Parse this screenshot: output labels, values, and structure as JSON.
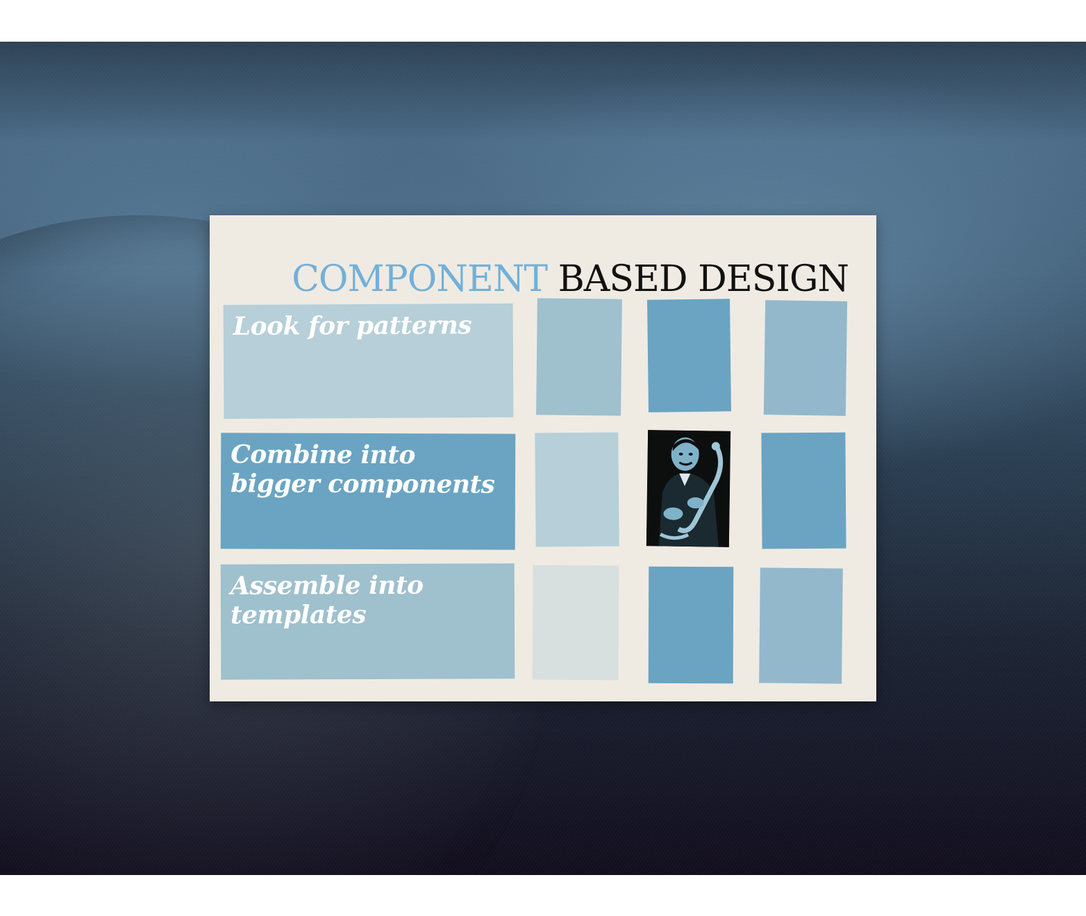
{
  "slide": {
    "title_accent": "COMPONENT",
    "title_main": "BASED DESIGN",
    "steps": [
      {
        "label": "Look for patterns"
      },
      {
        "label": "Combine into bigger components"
      },
      {
        "label": "Assemble into templates"
      }
    ],
    "photo": {
      "subject": "saxophone-player"
    }
  },
  "colors": {
    "card": "#efebe3",
    "accent": "#72b0d9",
    "light_blue": "#b6cfd8",
    "mid_blue": "#6aa4c2",
    "pale_blue": "#9fc0cd",
    "tile_blue": "#93b8cb"
  }
}
